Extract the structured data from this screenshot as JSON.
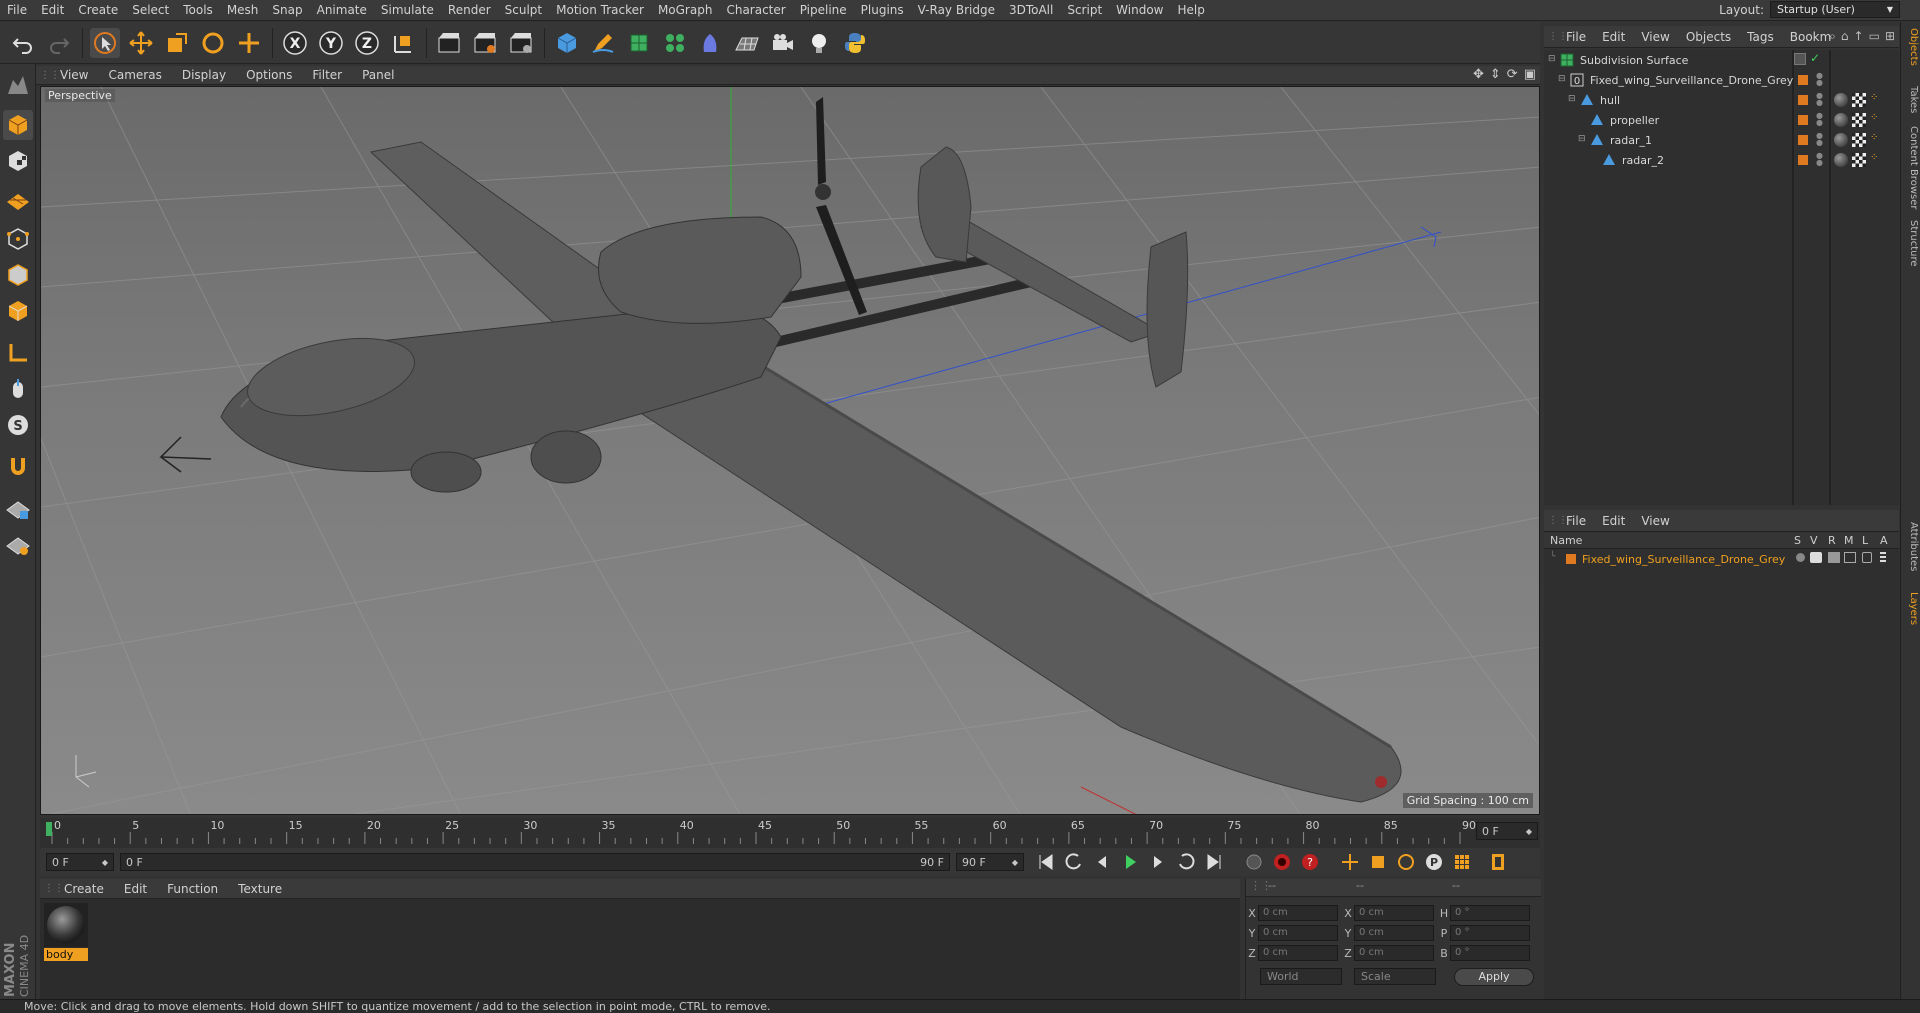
{
  "menubar": {
    "items": [
      "File",
      "Edit",
      "Create",
      "Select",
      "Tools",
      "Mesh",
      "Snap",
      "Animate",
      "Simulate",
      "Render",
      "Sculpt",
      "Motion Tracker",
      "MoGraph",
      "Character",
      "Pipeline",
      "Plugins",
      "V-Ray Bridge",
      "3DToAll",
      "Script",
      "Window",
      "Help"
    ],
    "layout_label": "Layout:",
    "layout_value": "Startup (User)"
  },
  "toolbar": {
    "icons": [
      "undo-icon",
      "redo-icon",
      "select-arrow-icon",
      "move-icon",
      "scale-icon",
      "rotate-icon",
      "move-plus-icon",
      "x-axis-icon",
      "y-axis-icon",
      "z-axis-icon",
      "coordinate-system-icon",
      "render-view-icon",
      "render-picture-viewer-icon",
      "edit-render-settings-icon",
      "cube-icon",
      "pen-icon",
      "subdivision-icon",
      "cloner-icon",
      "deformer-icon",
      "floor-icon",
      "camera-icon",
      "light-icon",
      "python-icon"
    ]
  },
  "viewport": {
    "menus": [
      "View",
      "Cameras",
      "Display",
      "Options",
      "Filter",
      "Panel"
    ],
    "label": "Perspective",
    "grid_spacing": "Grid Spacing : 100 cm"
  },
  "timeline": {
    "ticks": [
      "0",
      "5",
      "10",
      "15",
      "20",
      "25",
      "30",
      "35",
      "40",
      "45",
      "50",
      "55",
      "60",
      "65",
      "70",
      "75",
      "80",
      "85",
      "90"
    ],
    "current_frame": "0 F",
    "start_frame": "0 F",
    "range_start": "0 F",
    "range_end": "90 F",
    "end_frame": "90 F"
  },
  "materials": {
    "menus": [
      "Create",
      "Edit",
      "Function",
      "Texture"
    ],
    "items": [
      {
        "name": "body"
      }
    ]
  },
  "coordinates": {
    "header": [
      "--",
      "--",
      "--"
    ],
    "rows": [
      {
        "l1": "X",
        "v1": "0 cm",
        "l2": "X",
        "v2": "0 cm",
        "l3": "H",
        "v3": "0 °"
      },
      {
        "l1": "Y",
        "v1": "0 cm",
        "l2": "Y",
        "v2": "0 cm",
        "l3": "P",
        "v3": "0 °"
      },
      {
        "l1": "Z",
        "v1": "0 cm",
        "l2": "Z",
        "v2": "0 cm",
        "l3": "B",
        "v3": "0 °"
      }
    ],
    "space": "World",
    "mode": "Scale",
    "apply": "Apply"
  },
  "objects": {
    "menus": [
      "File",
      "Edit",
      "View",
      "Objects",
      "Tags",
      "Bookm"
    ],
    "tree": [
      {
        "name": "Subdivision Surface",
        "depth": 0
      },
      {
        "name": "Fixed_wing_Surveillance_Drone_Grey",
        "depth": 1
      },
      {
        "name": "hull",
        "depth": 2
      },
      {
        "name": "propeller",
        "depth": 3
      },
      {
        "name": "radar_1",
        "depth": 3
      },
      {
        "name": "radar_2",
        "depth": 4
      }
    ]
  },
  "layers": {
    "menus": [
      "File",
      "Edit",
      "View"
    ],
    "columns": [
      "Name",
      "S",
      "V",
      "R",
      "M",
      "L",
      "A"
    ],
    "items": [
      {
        "name": "Fixed_wing_Surveillance_Drone_Grey"
      }
    ]
  },
  "side_tabs": [
    "Objects",
    "Takes",
    "Content Browser",
    "Structure",
    "Attributes",
    "Layers"
  ],
  "brand": {
    "maxon": "MAXON",
    "product": "CINEMA 4D"
  },
  "status": "Move: Click and drag to move elements. Hold down SHIFT to quantize movement / add to the selection in point mode, CTRL to remove.",
  "colors": {
    "accent": "#f0a020",
    "layer_text": "#f0a020",
    "x_axis": "#c03030",
    "y_axis": "#30a030",
    "z_axis": "#3050d0"
  }
}
